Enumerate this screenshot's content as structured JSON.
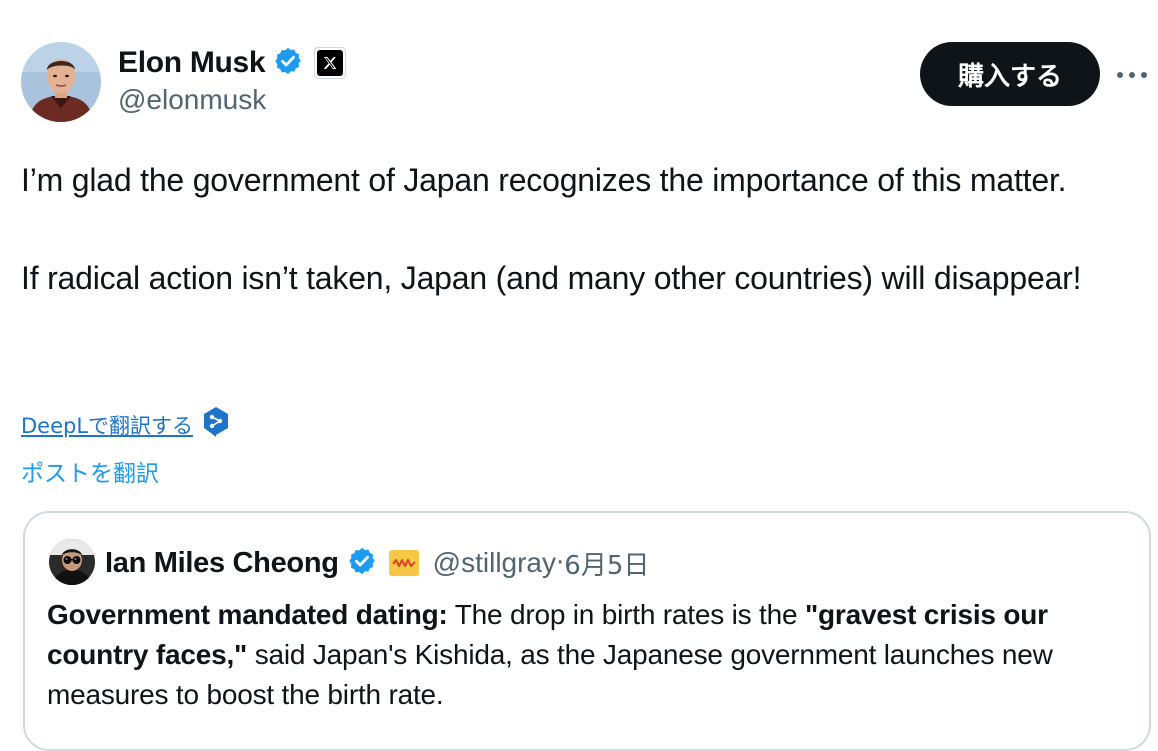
{
  "post": {
    "author": {
      "name": "Elon Musk",
      "handle": "@elonmusk",
      "avatar_icon": "elon-musk-avatar",
      "verified_icon": "verified-badge-icon",
      "affiliation_icon": "x-logo-icon"
    },
    "buy_label": "購入する",
    "more_icon": "more-options-icon",
    "text_para1": "I’m glad the government of Japan recognizes the importance of this matter.",
    "text_para2": "If radical action isn’t taken, Japan (and many other countries) will disappear!",
    "deepl_label": "DeepLで翻訳する",
    "deepl_icon": "deepl-logo-icon",
    "translate_label": "ポストを翻訳"
  },
  "quote": {
    "author_name": "Ian Miles Cheong",
    "handle": "@stillgray",
    "separator": " · ",
    "date": "6月5日",
    "avatar_icon": "ian-miles-cheong-avatar",
    "verified_icon": "verified-badge-icon",
    "emoji_icon": "emoji-badge-icon",
    "text_bold1": "Government mandated dating:",
    "text_normal1": " The drop in birth rates is the ",
    "text_bold2": "\"gravest crisis our country faces,\"",
    "text_normal2": " said Japan's Kishida, as the Japanese government launches new measures to boost the birth rate."
  },
  "colors": {
    "link_blue": "#1d9bf0",
    "deepl_blue": "#1d74c9",
    "verified_blue": "#1d9bf0",
    "text_primary": "#0f1419",
    "text_secondary": "#536471",
    "border": "#cfd9de"
  }
}
